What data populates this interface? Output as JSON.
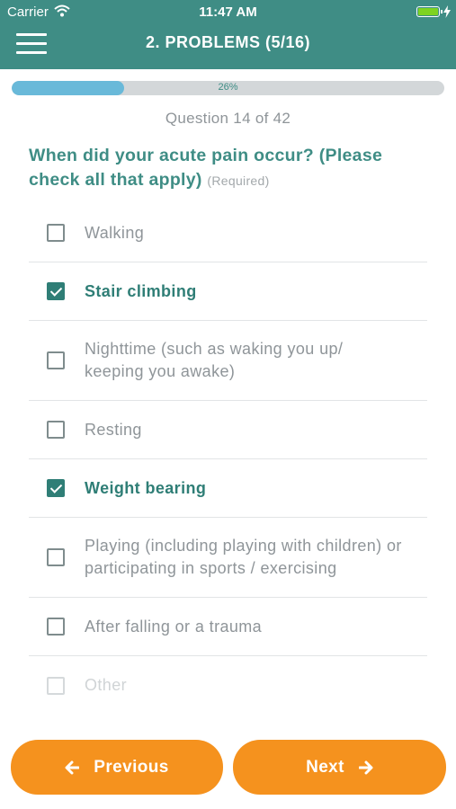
{
  "status_bar": {
    "carrier": "Carrier",
    "time": "11:47 AM"
  },
  "header": {
    "title": "2. PROBLEMS (5/16)"
  },
  "progress": {
    "percent_label": "26%",
    "value": 0.26
  },
  "question": {
    "counter": "Question 14 of 42",
    "text": "When did your acute pain occur? (Please check all that apply)",
    "required_label": "(Required)"
  },
  "options": [
    {
      "label": "Walking",
      "checked": false
    },
    {
      "label": "Stair climbing",
      "checked": true
    },
    {
      "label": "Nighttime (such as waking you up/ keeping you awake)",
      "checked": false
    },
    {
      "label": "Resting",
      "checked": false
    },
    {
      "label": "Weight bearing",
      "checked": true
    },
    {
      "label": "Playing (including playing with children) or participating in sports / exercising",
      "checked": false
    },
    {
      "label": "After falling or a trauma",
      "checked": false
    },
    {
      "label": "Other",
      "checked": false,
      "faded": true
    }
  ],
  "buttons": {
    "previous": "Previous",
    "next": "Next"
  },
  "colors": {
    "header": "#3f8d85",
    "accent": "#2f7e76",
    "button": "#f5921e",
    "progress": "#69b9d9"
  }
}
